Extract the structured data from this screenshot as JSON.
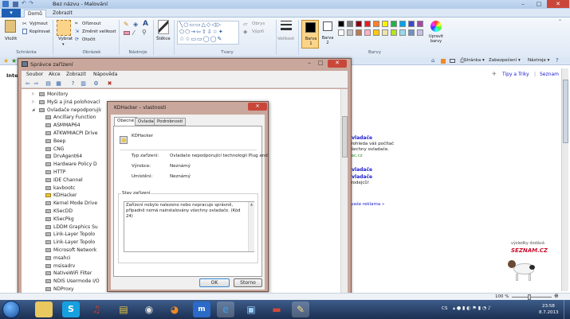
{
  "paint": {
    "title": "Bez názvu - Malování",
    "file_menu": "▾",
    "tabs": [
      "Domů",
      "Zobrazit"
    ],
    "clipboard": {
      "paste": "Vložit",
      "cut": "Vyjmout",
      "copy": "Kopírovat",
      "group": "Schránka"
    },
    "image": {
      "select": "Vybrat",
      "crop": "Oříznout",
      "resize": "Změnit velikost",
      "rotate": "Otočit",
      "group": "Obrázek"
    },
    "tools": {
      "group": "Nástroje"
    },
    "brushes": "Štětce",
    "shapes": {
      "outline": "Obrys",
      "fill": "Výplň",
      "group": "Tvary"
    },
    "size": "Velikost",
    "color1": "Barva 1",
    "color2": "Barva 2",
    "edit_colors": "Upravit barvy",
    "colors_group": "Barvy",
    "palette_colors": [
      "#000000",
      "#7f7f7f",
      "#880015",
      "#ed1c24",
      "#ff7f27",
      "#fff200",
      "#22b14c",
      "#00a2e8",
      "#3f48cc",
      "#a349a4",
      "#ffffff",
      "#c3c3c3",
      "#b97a57",
      "#ffaec9",
      "#ffc90e",
      "#efe4b0",
      "#b5e61d",
      "#99d9ea",
      "#7092be",
      "#c8bfe7"
    ]
  },
  "ie": {
    "cmd_right": [
      "Stránka ▾",
      "Zabezpečení ▾",
      "Nástroje ▾"
    ],
    "links": [
      "Tipy a Triky",
      "Seznam"
    ],
    "inter": "Inter",
    "right_snippets": [
      "ovladače",
      "prohleda váš počítač",
      "všechny ovladače.",
      "dac.cz",
      "ovladače",
      "ovladače",
      "prodejců!",
      "i vaše reklama »"
    ],
    "seznam_caption": "výsledky dodává",
    "seznam_logo": "SEZNAM.CZ",
    "zoom": "100 %"
  },
  "devmgr": {
    "title": "Správce zařízení",
    "menu": [
      "Soubor",
      "Akce",
      "Zobrazit",
      "Nápověda"
    ],
    "tree": [
      {
        "label": "Monitory",
        "indent": 1,
        "expander": "▷"
      },
      {
        "label": "Myši a jiná polohovací zař.",
        "indent": 1,
        "expander": "▷"
      },
      {
        "label": "Ovladače nepodporujíc",
        "indent": 1,
        "expander": "◢"
      },
      {
        "label": "Ancillary Function",
        "indent": 2
      },
      {
        "label": "ASMMAP64",
        "indent": 2
      },
      {
        "label": "ATKWMIACPI Drive",
        "indent": 2
      },
      {
        "label": "Beep",
        "indent": 2
      },
      {
        "label": "CNG",
        "indent": 2
      },
      {
        "label": "DrvAgent64",
        "indent": 2
      },
      {
        "label": "Hardware Policy D",
        "indent": 2
      },
      {
        "label": "HTTP",
        "indent": 2
      },
      {
        "label": "IDE Channel",
        "indent": 2
      },
      {
        "label": "kavbootc",
        "indent": 2
      },
      {
        "label": "KDHacker",
        "indent": 2,
        "warn": true
      },
      {
        "label": "Kernel Mode Drive",
        "indent": 2
      },
      {
        "label": "KSecDD",
        "indent": 2
      },
      {
        "label": "KSecPkg",
        "indent": 2
      },
      {
        "label": "LDDM Graphics Su",
        "indent": 2
      },
      {
        "label": "Link-Layer Topolo",
        "indent": 2
      },
      {
        "label": "Link-Layer Topolo",
        "indent": 2
      },
      {
        "label": "Microsoft Network",
        "indent": 2
      },
      {
        "label": "msahci",
        "indent": 2
      },
      {
        "label": "msisadrv",
        "indent": 2
      },
      {
        "label": "NativeWiFi Filter",
        "indent": 2
      },
      {
        "label": "NDIS Usermode I/O",
        "indent": 2
      },
      {
        "label": "NDProxy",
        "indent": 2
      }
    ]
  },
  "props": {
    "title": "KDHacker – vlastnosti",
    "close": "✕",
    "tabs": [
      "Obecné",
      "Ovladač",
      "Podrobnosti"
    ],
    "device_name": "KDHacker",
    "fields": [
      {
        "label": "Typ zařízení:",
        "value": "Ovladače nepodporující technologii Plug and"
      },
      {
        "label": "Výrobce:",
        "value": "Neznámý"
      },
      {
        "label": "Umístění:",
        "value": "Neznámý"
      }
    ],
    "status_group": "Stav zařízení",
    "status_text": "Zařízení nebylo nalezeno nebo nepracuje správně, případně nemá nainstalovány všechny ovladače. (Kód 24)",
    "ok": "OK",
    "cancel": "Storno"
  },
  "taskbar": {
    "lang": "CS",
    "time": "23:58",
    "date": "8.7.2013"
  }
}
